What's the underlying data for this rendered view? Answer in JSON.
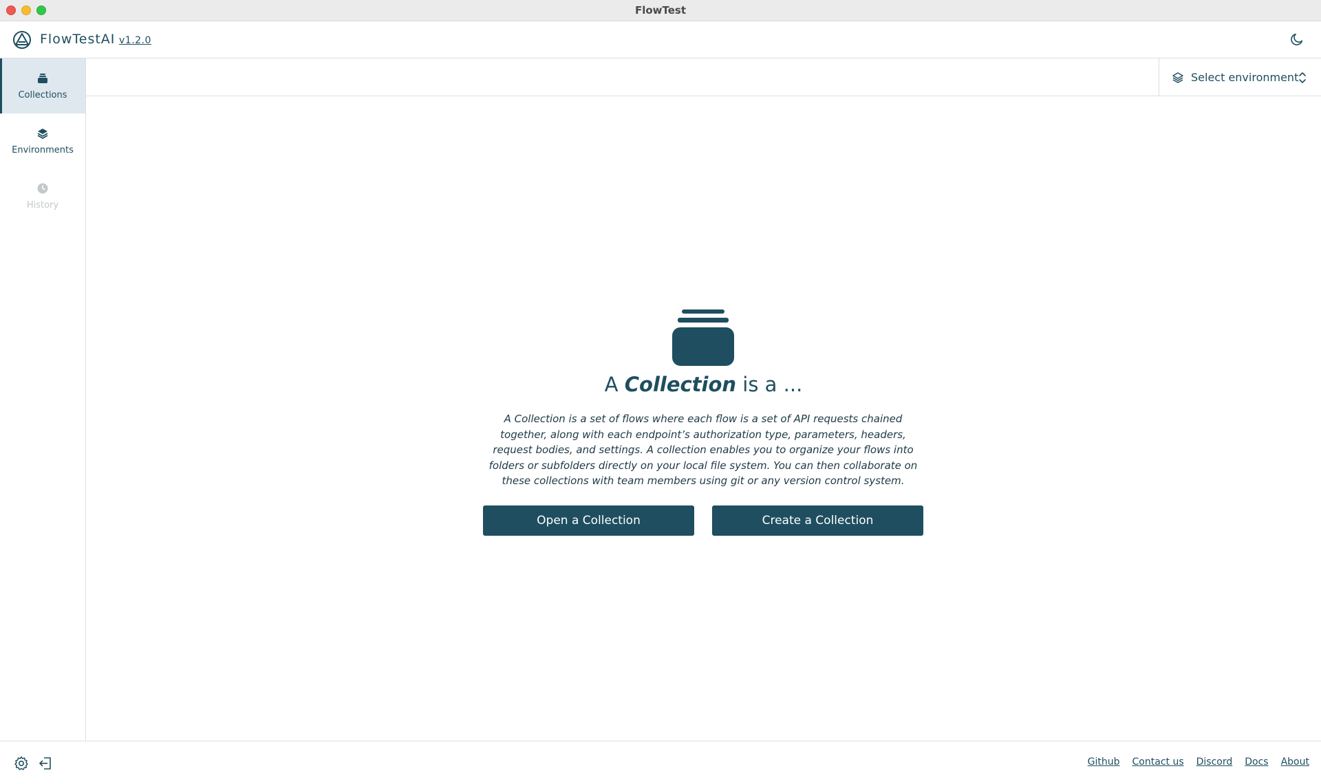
{
  "window": {
    "title": "FlowTest"
  },
  "header": {
    "brand": "FlowTestAI",
    "version": "v1.2.0"
  },
  "sidebar": {
    "items": [
      {
        "label": "Collections",
        "icon": "collections-icon",
        "active": true
      },
      {
        "label": "Environments",
        "icon": "layers-icon",
        "active": false
      },
      {
        "label": "History",
        "icon": "clock-icon",
        "disabled": true
      }
    ]
  },
  "topbar": {
    "environment_placeholder": "Select environment"
  },
  "main": {
    "heading_prefix": "A",
    "heading_emphasis": "Collection",
    "heading_suffix": "is a ...",
    "description": "A Collection is a set of flows where each flow is a set of API requests chained together, along with each endpoint’s authorization type, parameters, headers, request bodies, and settings. A collection enables you to organize your flows into folders or subfolders directly on your local file system. You can then collaborate on these collections with team members using git or any version control system.",
    "open_button": "Open a Collection",
    "create_button": "Create a Collection"
  },
  "footer": {
    "links": [
      "Github",
      "Contact us",
      "Discord",
      "Docs",
      "About"
    ]
  },
  "colors": {
    "accent": "#1e4e5f",
    "active_bg": "#dfe8ee",
    "disabled": "#c3c8cb"
  }
}
